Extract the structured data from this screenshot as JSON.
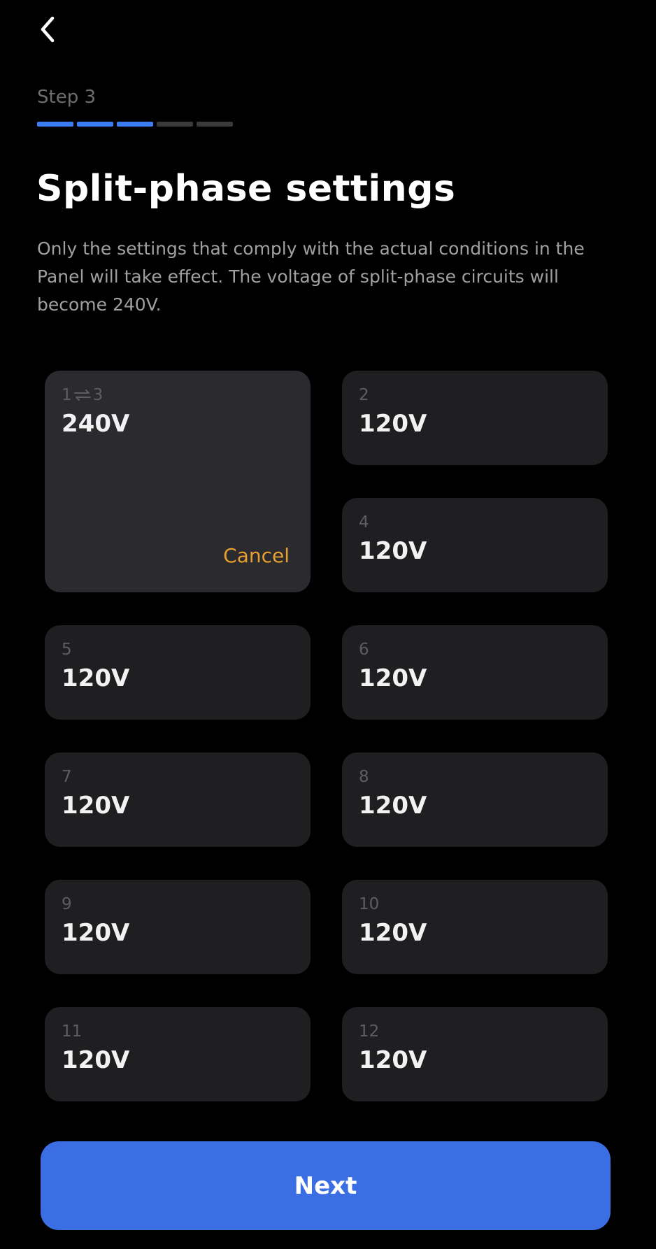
{
  "header": {
    "back_icon": "chevron-left-icon",
    "step_label": "Step 3",
    "progress": {
      "total_steps": 5,
      "completed_steps": 3
    }
  },
  "title": "Split-phase settings",
  "description": "Only the settings that comply with the actual conditions in the Panel will take effect. The voltage of split-phase circuits will become 240V.",
  "linked_circuit": {
    "from": "1",
    "to": "3",
    "link_icon": "link-arrows-icon",
    "voltage": "240V",
    "cancel_label": "Cancel"
  },
  "circuits": [
    {
      "number": "2",
      "voltage": "120V"
    },
    {
      "number": "4",
      "voltage": "120V"
    },
    {
      "number": "5",
      "voltage": "120V"
    },
    {
      "number": "6",
      "voltage": "120V"
    },
    {
      "number": "7",
      "voltage": "120V"
    },
    {
      "number": "8",
      "voltage": "120V"
    },
    {
      "number": "9",
      "voltage": "120V"
    },
    {
      "number": "10",
      "voltage": "120V"
    },
    {
      "number": "11",
      "voltage": "120V"
    },
    {
      "number": "12",
      "voltage": "120V"
    }
  ],
  "next_label": "Next",
  "colors": {
    "accent": "#3b6de3",
    "progress_active": "#3b7cf0",
    "cancel": "#e6a030",
    "card": "#1f1e21"
  }
}
